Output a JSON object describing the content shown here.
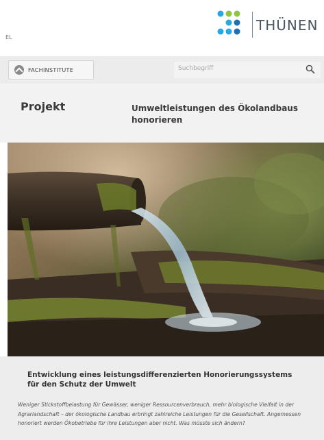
{
  "header": {
    "lang_label": "EL",
    "logo_text": "THÜNEN",
    "logo_icon": "thunen-dot-logo",
    "accent_colors": [
      "#8dc63f",
      "#29a8e0",
      "#1f6fb5"
    ]
  },
  "nav": {
    "institutes_label": "FACHINSTITUTE",
    "institutes_icon": "chevron-up-circle-icon",
    "search_placeholder": "Suchbegriff",
    "search_icon": "search-icon"
  },
  "project": {
    "label": "Projekt",
    "title": "Umweltleistungen des Ökolandbaus honorieren"
  },
  "article": {
    "subtitle": "Entwicklung eines leistungsdifferenzierten Honorierungssystems für den Schutz der Umwelt",
    "body": "Weniger Stickstoffbelastung für Gewässer, weniger Ressourcenverbrauch, mehr biologische Vielfalt in der Agrarlandschaft – der ökologische Landbau erbringt zahlreiche Leistungen für die Gesellschaft. Angemessen honoriert werden Ökobetriebe für ihre Leistungen aber nicht. Was müsste sich ändern?"
  }
}
